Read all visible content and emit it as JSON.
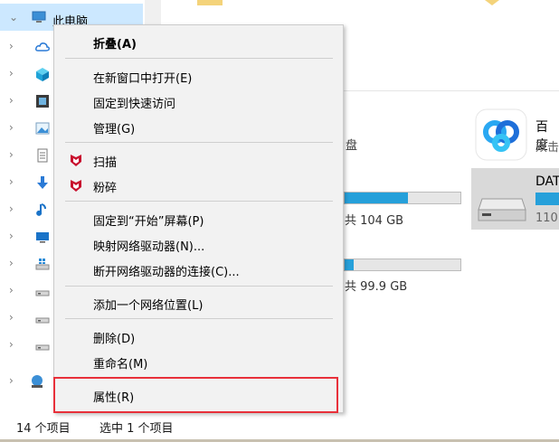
{
  "nav": {
    "this_pc_label": "此电脑",
    "icons": [
      "onedrive-icon",
      "3d-objects-icon",
      "videos-icon",
      "pictures-icon",
      "documents-icon",
      "downloads-icon",
      "music-icon",
      "desktop-icon",
      "windows-drive-icon",
      "drive-icon",
      "drive-icon",
      "drive-icon",
      "drive-icon",
      "network-icon"
    ]
  },
  "content": {
    "partial_disk_label": "盘",
    "drive1_free": "共 104 GB",
    "drive1_fill_percent": 55,
    "drive2_free": "共 99.9 GB",
    "drive2_fill_percent": 8,
    "app_name": "百度",
    "app_sub": "双击",
    "data_drive_label": "DAT",
    "data_drive_size": "110",
    "accent": "#26a0da"
  },
  "menu": {
    "items": [
      {
        "label": "折叠(A)"
      },
      {
        "label": "在新窗口中打开(E)"
      },
      {
        "label": "固定到快速访问"
      },
      {
        "label": "管理(G)"
      },
      {
        "label": "扫描"
      },
      {
        "label": "粉碎"
      },
      {
        "label": "固定到“开始”屏幕(P)"
      },
      {
        "label": "映射网络驱动器(N)..."
      },
      {
        "label": "断开网络驱动器的连接(C)..."
      },
      {
        "label": "添加一个网络位置(L)"
      },
      {
        "label": "删除(D)"
      },
      {
        "label": "重命名(M)"
      },
      {
        "label": "属性(R)"
      }
    ],
    "highlight_color": "#e8303a"
  },
  "status": {
    "item_count": "14 个项目",
    "selected": "选中 1 个项目"
  }
}
